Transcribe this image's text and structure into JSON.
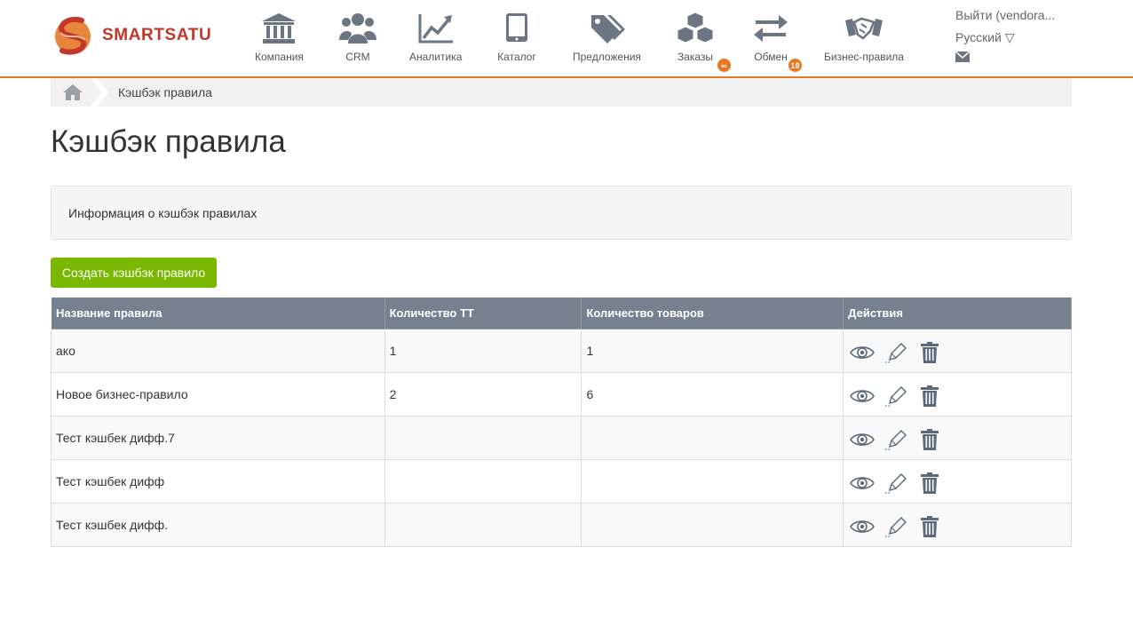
{
  "brand": {
    "name": "SMARTSATU",
    "accent": "#e87722",
    "logo_red": "#c4362a"
  },
  "nav": {
    "items": [
      {
        "label": "Компания",
        "icon": "bank-icon"
      },
      {
        "label": "CRM",
        "icon": "users-icon"
      },
      {
        "label": "Аналитика",
        "icon": "chart-line-icon"
      },
      {
        "label": "Каталог",
        "icon": "tablet-icon"
      },
      {
        "label": "Предложения",
        "icon": "tags-icon"
      },
      {
        "label": "Заказы",
        "icon": "cubes-icon",
        "badge": "∞"
      },
      {
        "label": "Обмен",
        "icon": "exchange-icon",
        "badge": "18"
      },
      {
        "label": "Бизнес-правила",
        "icon": "handshake-icon"
      }
    ]
  },
  "user": {
    "logout": "Выйти (vendora...",
    "language": "Русский ▽",
    "mail_icon": "envelope-icon"
  },
  "breadcrumb": {
    "home_icon": "home-icon",
    "current": "Кэшбэк правила"
  },
  "page": {
    "title": "Кэшбэк правила",
    "info": "Информация о кэшбэк правилах",
    "create_button": "Создать кэшбэк правило"
  },
  "table": {
    "headers": [
      "Название правила",
      "Количество ТТ",
      "Количество товаров",
      "Действия"
    ],
    "rows": [
      {
        "name": "ако",
        "tt": "1",
        "goods": "1"
      },
      {
        "name": "Новое бизнес-правило",
        "tt": "2",
        "goods": "6"
      },
      {
        "name": "Тест кэшбек дифф.7",
        "tt": "",
        "goods": ""
      },
      {
        "name": "Тест кэшбек дифф",
        "tt": "",
        "goods": ""
      },
      {
        "name": "Тест кэшбек дифф.",
        "tt": "",
        "goods": ""
      }
    ],
    "action_icons": [
      "eye-icon",
      "pencil-icon",
      "trash-icon"
    ]
  },
  "colors": {
    "table_header": "#76818f",
    "create_button": "#7ab800"
  }
}
